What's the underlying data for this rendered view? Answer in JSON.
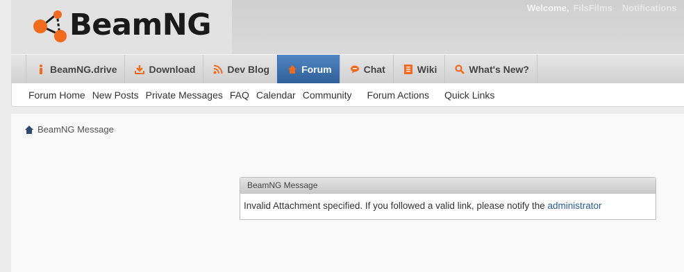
{
  "header": {
    "logo_text": "BeamNG",
    "welcome_label": "Welcome,",
    "username": "FilsFilms",
    "notifications_label": "Notifications"
  },
  "nav": {
    "tabs": [
      {
        "label": "BeamNG.drive",
        "icon": "info-icon"
      },
      {
        "label": "Download",
        "icon": "download-icon"
      },
      {
        "label": "Dev Blog",
        "icon": "rss-icon"
      },
      {
        "label": "Forum",
        "icon": "home-icon",
        "active": true
      },
      {
        "label": "Chat",
        "icon": "chat-icon"
      },
      {
        "label": "Wiki",
        "icon": "book-icon"
      },
      {
        "label": "What's New?",
        "icon": "search-icon"
      }
    ]
  },
  "subnav": {
    "links": [
      "Forum Home",
      "New Posts",
      "Private Messages",
      "FAQ",
      "Calendar",
      "Community",
      "Forum Actions",
      "Quick Links"
    ]
  },
  "breadcrumb": {
    "label": "BeamNG Message"
  },
  "message": {
    "title": "BeamNG Message",
    "text": "Invalid Attachment specified. If you followed a valid link, please notify the",
    "link": "administrator"
  },
  "colors": {
    "accent_orange": "#f26b1d",
    "active_tab": "#3a6fae",
    "link": "#2a5a9e"
  }
}
